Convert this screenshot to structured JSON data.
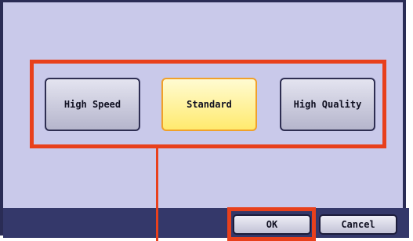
{
  "options": {
    "high_speed_label": "High Speed",
    "standard_label": "Standard",
    "high_quality_label": "High Quality",
    "selected": "Standard"
  },
  "actions": {
    "ok_label": "OK",
    "cancel_label": "Cancel"
  },
  "colors": {
    "panel_background": "#c9c9ea",
    "frame": "#2a2c55",
    "bottom_bar": "#34386a",
    "selected_button": "#ffea6e",
    "highlight": "#e8401c"
  }
}
